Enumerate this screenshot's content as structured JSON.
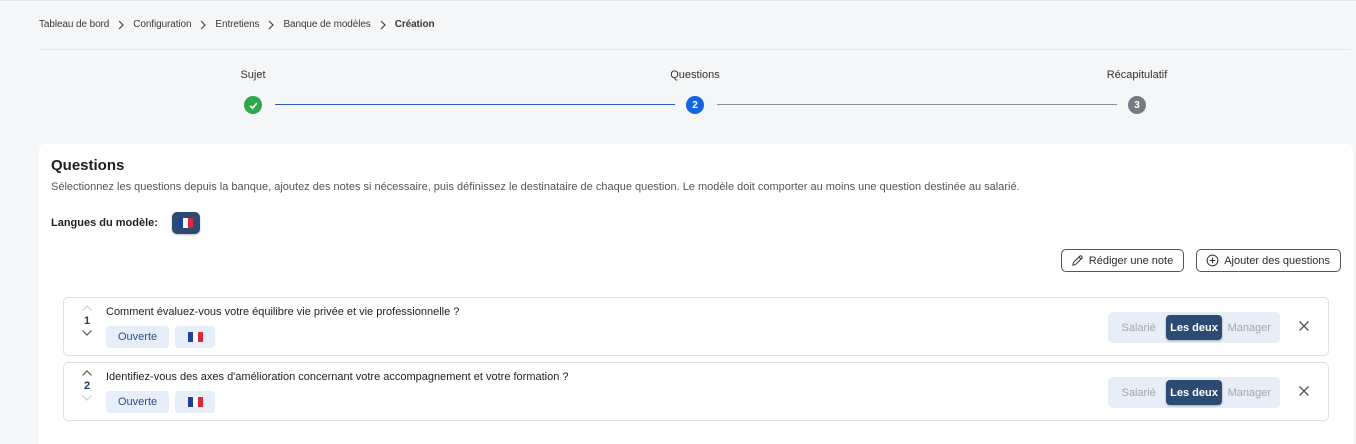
{
  "breadcrumb": {
    "items": [
      "Tableau de bord",
      "Configuration",
      "Entretiens",
      "Banque de modèles"
    ],
    "current": "Création"
  },
  "stepper": {
    "steps": [
      {
        "label": "Sujet",
        "status": "done"
      },
      {
        "label": "Questions",
        "status": "active",
        "number": "2"
      },
      {
        "label": "Récapitulatif",
        "status": "todo",
        "number": "3"
      }
    ]
  },
  "card": {
    "title": "Questions",
    "description": "Sélectionnez les questions depuis la banque, ajoutez des notes si nécessaire, puis définissez le destinataire de chaque question. Le modèle doit comporter au moins une question destinée au salarié.",
    "languages_label": "Langues du modèle:",
    "language_flag": "flag-fr-icon"
  },
  "actions": {
    "write_note": "Rédiger une note",
    "add_questions": "Ajouter des questions"
  },
  "questions": [
    {
      "number": "1",
      "text": "Comment évaluez-vous votre équilibre vie privée et vie professionnelle ?",
      "type": "Ouverte",
      "recipients": [
        "Salarié",
        "Les deux",
        "Manager"
      ],
      "selected": "Les deux"
    },
    {
      "number": "2",
      "text": "Identifiez-vous des axes d'amélioration concernant votre accompagnement et votre formation ?",
      "type": "Ouverte",
      "recipients": [
        "Salarié",
        "Les deux",
        "Manager"
      ],
      "selected": "Les deux"
    }
  ],
  "colors": {
    "primary_dark": "#2d4a72",
    "step_done": "#2fa84a",
    "step_active": "#1565e0",
    "step_todo": "#777a80",
    "tag_bg": "#e6eef9"
  }
}
